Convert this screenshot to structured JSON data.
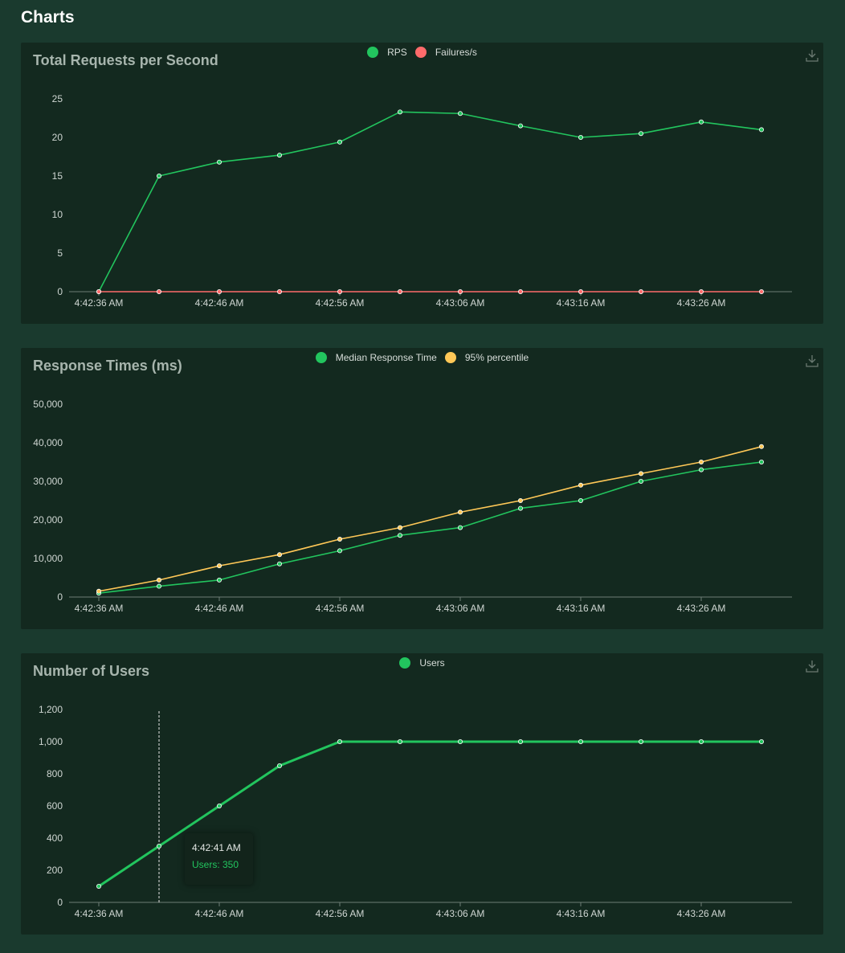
{
  "page": {
    "title": "Charts"
  },
  "charts": [
    {
      "id": "rps",
      "title": "Total Requests per Second",
      "legend": [
        {
          "label": "RPS",
          "color": "#22c55e"
        },
        {
          "label": "Failures/s",
          "color": "#ff6b6b"
        }
      ],
      "download_icon": "download-icon"
    },
    {
      "id": "response",
      "title": "Response Times (ms)",
      "legend": [
        {
          "label": "Median Response Time",
          "color": "#22c55e"
        },
        {
          "label": "95% percentile",
          "color": "#ffc857"
        }
      ],
      "download_icon": "download-icon"
    },
    {
      "id": "users",
      "title": "Number of Users",
      "legend": [
        {
          "label": "Users",
          "color": "#22c55e"
        }
      ],
      "download_icon": "download-icon",
      "tooltip": {
        "time": "4:42:41 AM",
        "value": "Users: 350"
      }
    }
  ],
  "chart_data": [
    {
      "type": "line",
      "title": "Total Requests per Second",
      "x": [
        "4:42:36 AM",
        "4:42:41 AM",
        "4:42:46 AM",
        "4:42:51 AM",
        "4:42:56 AM",
        "4:43:01 AM",
        "4:43:06 AM",
        "4:43:11 AM",
        "4:43:16 AM",
        "4:43:21 AM",
        "4:43:26 AM",
        "4:43:31 AM"
      ],
      "x_tick_labels": [
        "4:42:36 AM",
        "4:42:46 AM",
        "4:42:56 AM",
        "4:43:06 AM",
        "4:43:16 AM",
        "4:43:26 AM"
      ],
      "y_ticks": [
        "0",
        "5",
        "10",
        "15",
        "20",
        "25"
      ],
      "ylim": [
        0,
        25
      ],
      "series": [
        {
          "name": "RPS",
          "color": "#22c55e",
          "values": [
            0,
            15,
            16.8,
            17.7,
            19.4,
            23.3,
            23.1,
            21.5,
            20,
            20.5,
            22,
            21
          ]
        },
        {
          "name": "Failures/s",
          "color": "#ff6b6b",
          "values": [
            0,
            0,
            0,
            0,
            0,
            0,
            0,
            0,
            0,
            0,
            0,
            0
          ]
        }
      ],
      "grid": false,
      "legend_position": "top-center"
    },
    {
      "type": "line",
      "title": "Response Times (ms)",
      "x": [
        "4:42:36 AM",
        "4:42:41 AM",
        "4:42:46 AM",
        "4:42:51 AM",
        "4:42:56 AM",
        "4:43:01 AM",
        "4:43:06 AM",
        "4:43:11 AM",
        "4:43:16 AM",
        "4:43:21 AM",
        "4:43:26 AM",
        "4:43:31 AM"
      ],
      "x_tick_labels": [
        "4:42:36 AM",
        "4:42:46 AM",
        "4:42:56 AM",
        "4:43:06 AM",
        "4:43:16 AM",
        "4:43:26 AM"
      ],
      "y_ticks": [
        "0",
        "10,000",
        "20,000",
        "30,000",
        "40,000",
        "50,000"
      ],
      "ylim": [
        0,
        50000
      ],
      "series": [
        {
          "name": "Median Response Time",
          "color": "#22c55e",
          "values": [
            1000,
            2800,
            4400,
            8600,
            12000,
            16000,
            18000,
            23000,
            25000,
            30000,
            33000,
            35000
          ]
        },
        {
          "name": "95% percentile",
          "color": "#ffc857",
          "values": [
            1500,
            4400,
            8100,
            11000,
            15000,
            18000,
            22000,
            25000,
            29000,
            32000,
            35000,
            39000
          ]
        }
      ],
      "grid": false,
      "legend_position": "top-center"
    },
    {
      "type": "line",
      "title": "Number of Users",
      "x": [
        "4:42:36 AM",
        "4:42:41 AM",
        "4:42:46 AM",
        "4:42:51 AM",
        "4:42:56 AM",
        "4:43:01 AM",
        "4:43:06 AM",
        "4:43:11 AM",
        "4:43:16 AM",
        "4:43:21 AM",
        "4:43:26 AM",
        "4:43:31 AM"
      ],
      "x_tick_labels": [
        "4:42:36 AM",
        "4:42:46 AM",
        "4:42:56 AM",
        "4:43:06 AM",
        "4:43:16 AM",
        "4:43:26 AM"
      ],
      "y_ticks": [
        "0",
        "200",
        "400",
        "600",
        "800",
        "1,000",
        "1,200"
      ],
      "ylim": [
        0,
        1200
      ],
      "series": [
        {
          "name": "Users",
          "color": "#22c55e",
          "values": [
            100,
            350,
            600,
            850,
            1000,
            1000,
            1000,
            1000,
            1000,
            1000,
            1000,
            1000
          ]
        }
      ],
      "grid": false,
      "legend_position": "top-center",
      "hover_index": 1
    }
  ]
}
